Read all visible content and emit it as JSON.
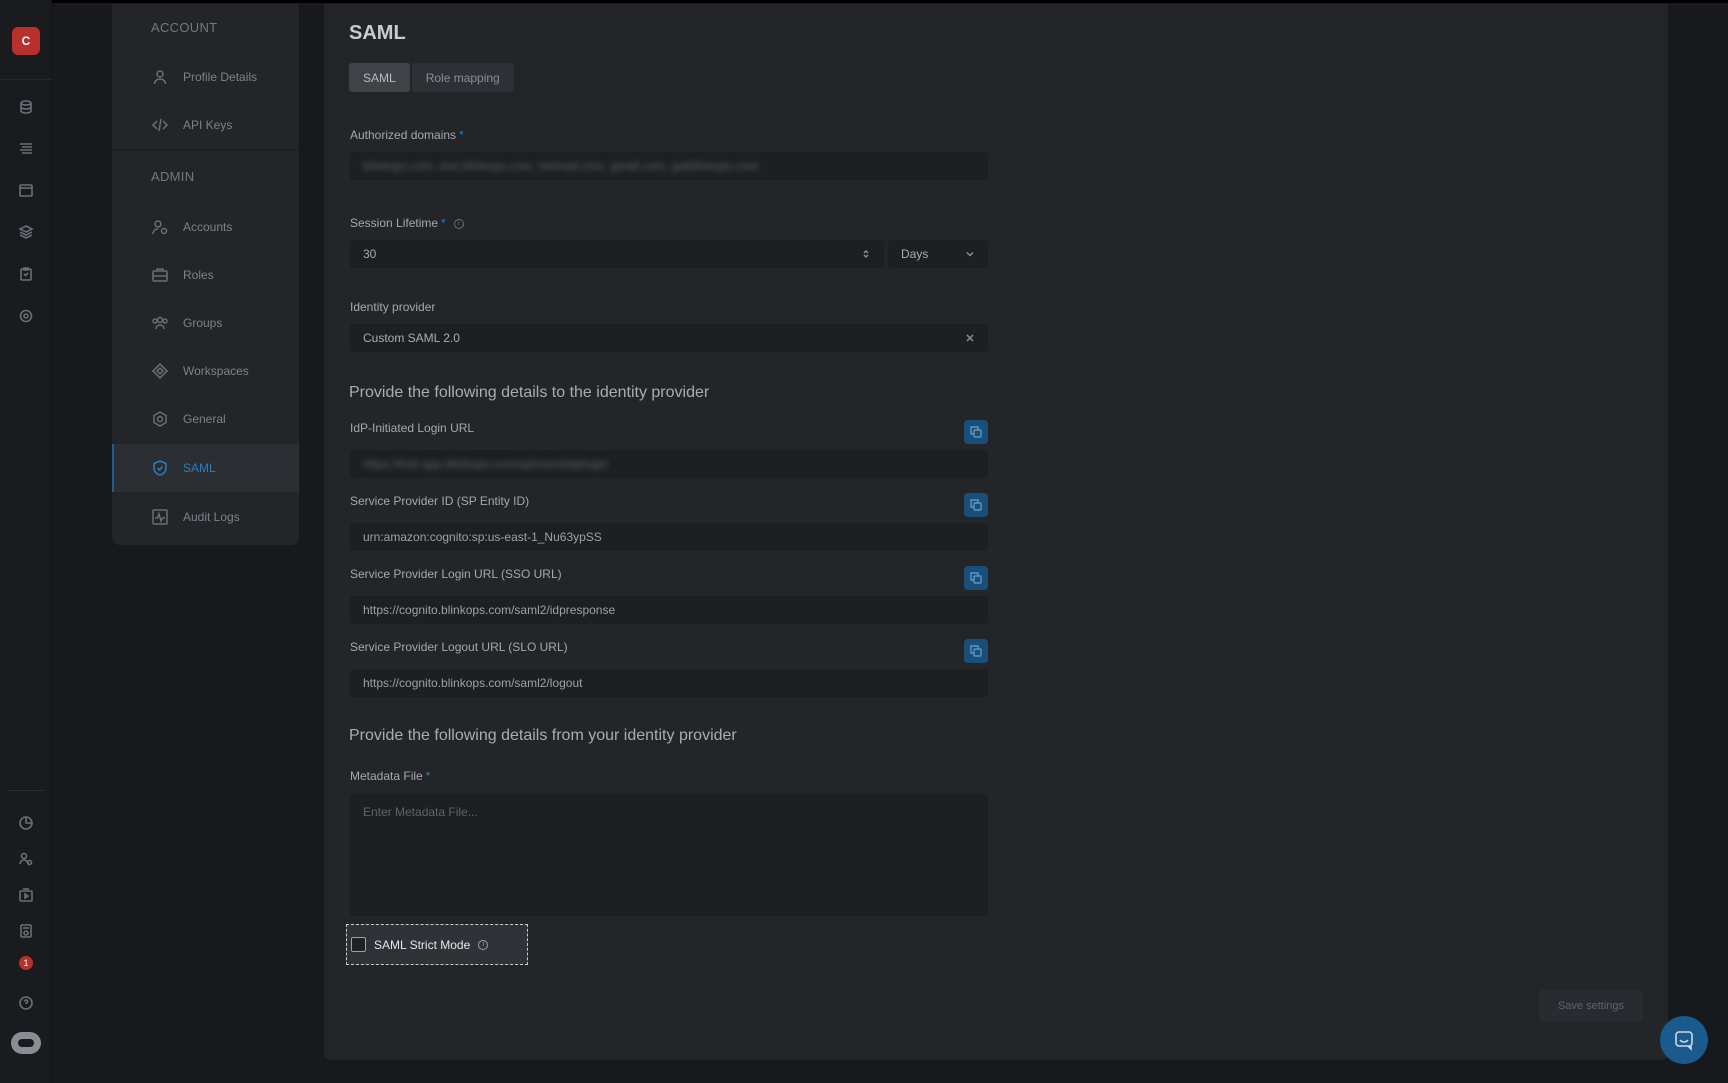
{
  "app": {
    "logo_letter": "C",
    "notification_count": "1"
  },
  "sidebar": {
    "account_section": "ACCOUNT",
    "admin_section": "ADMIN",
    "items": [
      {
        "label": "Profile Details",
        "icon": "user-icon"
      },
      {
        "label": "API Keys",
        "icon": "code-icon"
      },
      {
        "label": "Accounts",
        "icon": "accounts-icon"
      },
      {
        "label": "Roles",
        "icon": "briefcase-icon"
      },
      {
        "label": "Groups",
        "icon": "groups-icon"
      },
      {
        "label": "Workspaces",
        "icon": "diamond-icon"
      },
      {
        "label": "General",
        "icon": "gear-icon"
      },
      {
        "label": "SAML",
        "icon": "shield-icon",
        "active": true
      },
      {
        "label": "Audit Logs",
        "icon": "activity-icon"
      }
    ]
  },
  "page": {
    "title": "SAML",
    "tabs": [
      {
        "label": "SAML",
        "active": true
      },
      {
        "label": "Role mapping",
        "active": false
      }
    ]
  },
  "form": {
    "authorized_domains_label": "Authorized domains",
    "authorized_domains_value": "blinkops.com, test.blinkops.com, hotmail.com, gmail.com, getblinkops.com",
    "session_lifetime_label": "Session Lifetime",
    "session_lifetime_value": "30",
    "session_lifetime_unit": "Days",
    "identity_provider_label": "Identity provider",
    "identity_provider_value": "Custom SAML 2.0",
    "to_idp_heading": "Provide the following details to the identity provider",
    "idp_login_url_label": "IdP-Initiated Login URL",
    "idp_login_url_value": "https://trial.app.blinkops.com/api/saml/idplogin",
    "sp_entity_label": "Service Provider ID (SP Entity ID)",
    "sp_entity_value": "urn:amazon:cognito:sp:us-east-1_Nu63ypSS",
    "sso_url_label": "Service Provider Login URL (SSO URL)",
    "sso_url_value": "https://cognito.blinkops.com/saml2/idpresponse",
    "slo_url_label": "Service Provider Logout URL (SLO URL)",
    "slo_url_value": "https://cognito.blinkops.com/saml2/logout",
    "from_idp_heading": "Provide the following details from your identity provider",
    "metadata_label": "Metadata File",
    "metadata_placeholder": "Enter Metadata File...",
    "strict_mode_label": "SAML Strict Mode",
    "save_label": "Save settings",
    "required_mark": "*",
    "info_mark": "i"
  },
  "colors": {
    "accent": "#2c7fbf",
    "brand": "#b7302b"
  }
}
